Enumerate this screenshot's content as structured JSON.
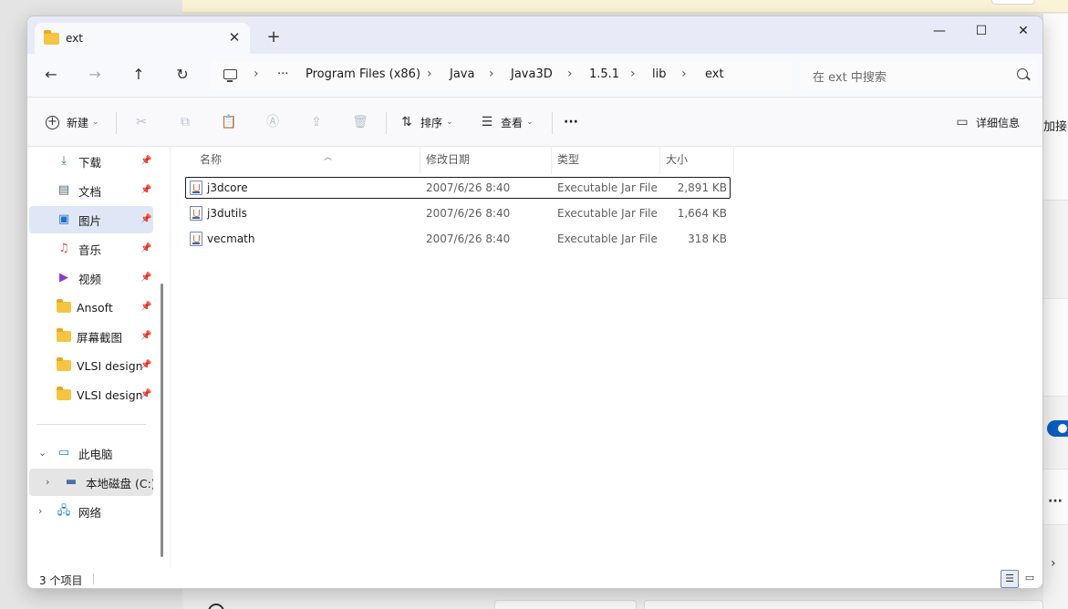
{
  "window": {
    "tab_title": "ext",
    "tab_close": "✕",
    "new_tab": "+",
    "minimize": "—",
    "maximize": "☐",
    "close": "✕"
  },
  "nav": {
    "back": "←",
    "forward": "→",
    "up": "↑",
    "refresh": "↻"
  },
  "breadcrumb": {
    "overflow": "···",
    "items": [
      "Program Files (x86)",
      "Java",
      "Java3D",
      "1.5.1",
      "lib",
      "ext"
    ],
    "separator": "›"
  },
  "search": {
    "placeholder": "在 ext 中搜索"
  },
  "toolbar": {
    "new_label": "新建",
    "sort_label": "排序",
    "view_label": "查看",
    "more_label": "···",
    "details_label": "详细信息",
    "icons": [
      "cut-icon",
      "copy-icon",
      "paste-icon",
      "rename-icon",
      "share-icon",
      "delete-icon"
    ]
  },
  "sidebar": {
    "quick_access": [
      {
        "label": "下载",
        "icon": "download-icon",
        "pinned": true
      },
      {
        "label": "文档",
        "icon": "document-icon",
        "pinned": true
      },
      {
        "label": "图片",
        "icon": "picture-icon",
        "pinned": true
      },
      {
        "label": "音乐",
        "icon": "music-icon",
        "pinned": true
      },
      {
        "label": "视频",
        "icon": "video-icon",
        "pinned": true
      },
      {
        "label": "Ansoft",
        "icon": "folder-icon",
        "pinned": true
      },
      {
        "label": "屏幕截图",
        "icon": "folder-icon",
        "pinned": true
      },
      {
        "label": "VLSI design",
        "icon": "folder-icon",
        "pinned": true
      },
      {
        "label": "VLSI design",
        "icon": "folder-icon",
        "pinned": true
      }
    ],
    "this_pc": "此电脑",
    "local_disk": "本地磁盘 (C:)",
    "network": "网络",
    "pin_glyph": "📌"
  },
  "file_list": {
    "columns": [
      "名称",
      "修改日期",
      "类型",
      "大小"
    ],
    "rows": [
      {
        "name": "j3dcore",
        "modified": "2007/6/26 8:40",
        "type": "Executable Jar File",
        "size": "2,891 KB"
      },
      {
        "name": "j3dutils",
        "modified": "2007/6/26 8:40",
        "type": "Executable Jar File",
        "size": "1,664 KB"
      },
      {
        "name": "vecmath",
        "modified": "2007/6/26 8:40",
        "type": "Executable Jar File",
        "size": "318 KB"
      }
    ]
  },
  "status": {
    "item_count": "3 个项目"
  },
  "background": {
    "cut_text": "加接"
  },
  "colors": {
    "accent": "#0a5dc2",
    "titlebar": "#e8ebf7",
    "selection": "#dfe7f6"
  }
}
